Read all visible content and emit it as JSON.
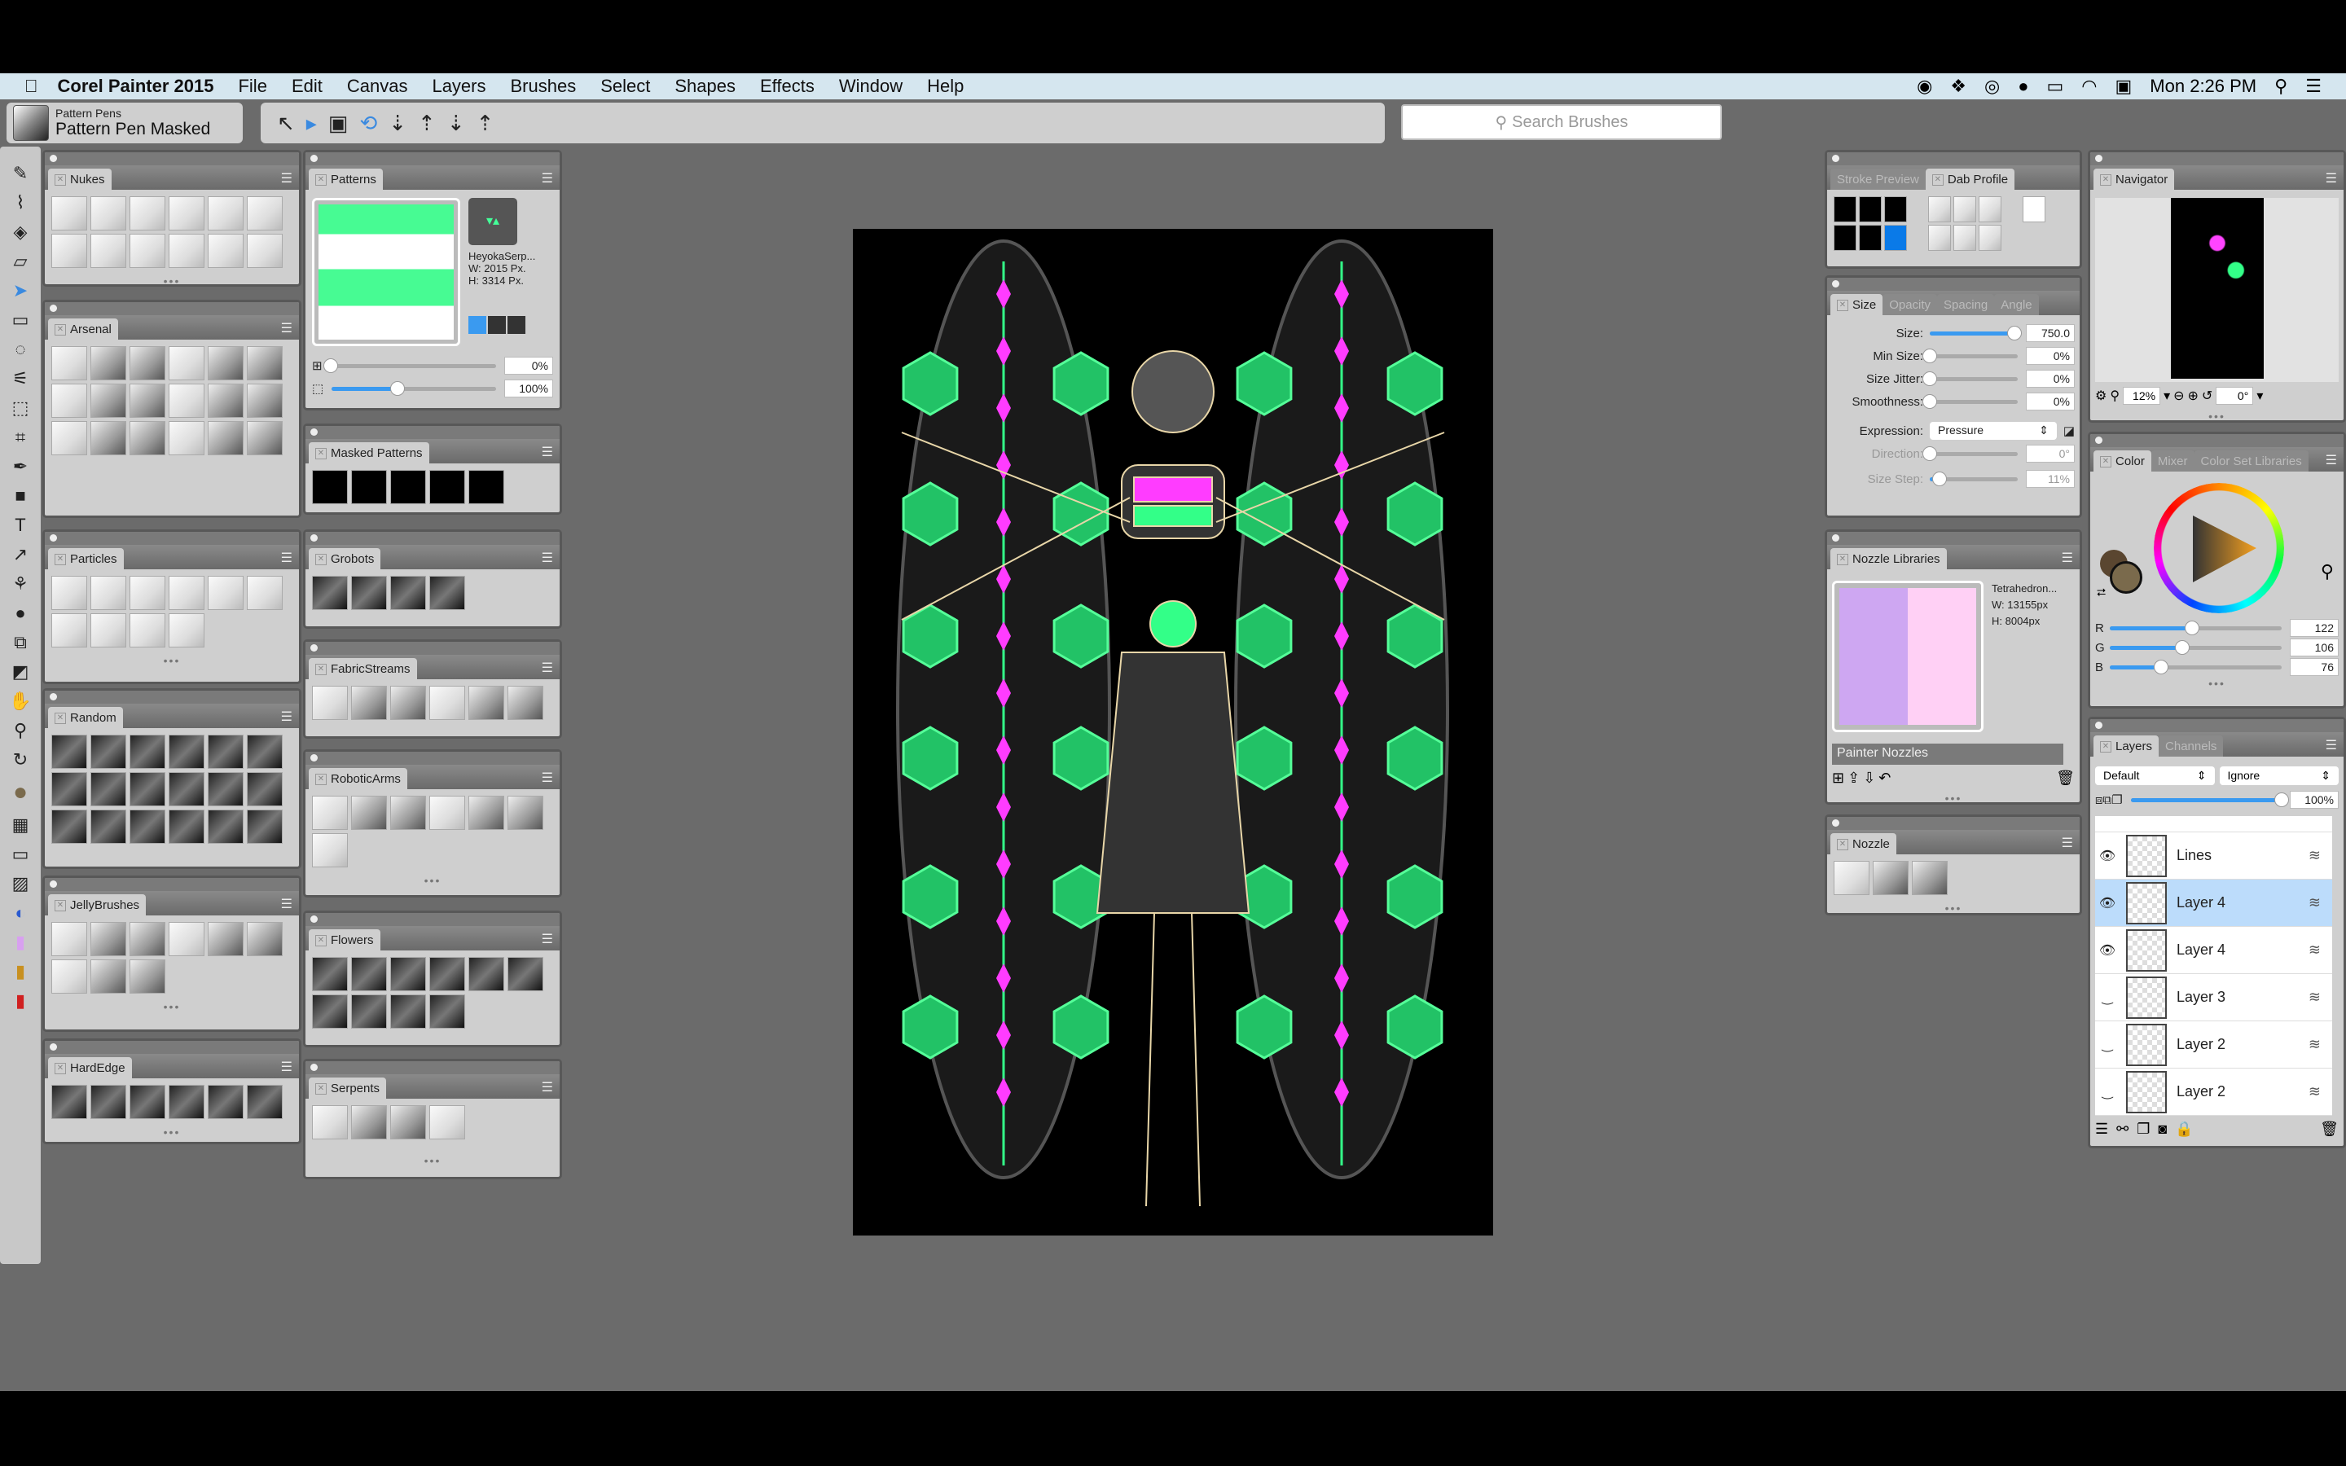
{
  "menubar": {
    "app": "Corel Painter 2015",
    "items": [
      "File",
      "Edit",
      "Canvas",
      "Layers",
      "Brushes",
      "Select",
      "Shapes",
      "Effects",
      "Window",
      "Help"
    ],
    "clock": "Mon 2:26 PM"
  },
  "toolbar": {
    "brush_category": "Pattern Pens",
    "brush_variant": "Pattern Pen Masked",
    "search_placeholder": "Search Brushes"
  },
  "left_panels": [
    {
      "title": "Nukes"
    },
    {
      "title": "Arsenal"
    },
    {
      "title": "Particles"
    },
    {
      "title": "Random"
    },
    {
      "title": "JellyBrushes"
    },
    {
      "title": "HardEdge"
    }
  ],
  "mid_panels": [
    {
      "title": "Patterns"
    },
    {
      "title": "Masked Patterns"
    },
    {
      "title": "Grobots"
    },
    {
      "title": "FabricStreams"
    },
    {
      "title": "RoboticArms"
    },
    {
      "title": "Flowers"
    },
    {
      "title": "Serpents"
    }
  ],
  "patterns": {
    "name": "HeyokaSerp...",
    "width": "W:  2015 Px.",
    "height": "H:  3314 Px.",
    "offset": "0%",
    "scale": "100%",
    "scale_value": 0.4,
    "swatch_colors": [
      "#47fb93",
      "#ffffff"
    ]
  },
  "stroke_panel": {
    "tabs": [
      "Stroke Preview",
      "Dab Profile"
    ],
    "active": "Dab Profile"
  },
  "size_panel": {
    "tabs": [
      "Size",
      "Opacity",
      "Spacing",
      "Angle"
    ],
    "rows": [
      {
        "label": "Size:",
        "value": "750.0",
        "level": 0.96
      },
      {
        "label": "Min Size:",
        "value": "0%",
        "level": 0
      },
      {
        "label": "Size Jitter:",
        "value": "0%",
        "level": 0
      },
      {
        "label": "Smoothness:",
        "value": "0%",
        "level": 0
      }
    ],
    "expression_label": "Expression:",
    "expression": "Pressure",
    "direction_label": "Direction:",
    "direction": "0°",
    "size_step_label": "Size Step:",
    "size_step": "11%"
  },
  "nozzle_libraries": {
    "title": "Nozzle Libraries",
    "name": "Tetrahedron...",
    "width": "W: 13155px",
    "height": "H: 8004px",
    "library": "Painter Nozzles",
    "colors": [
      "#cea7f2",
      "#ffd0f5"
    ]
  },
  "nozzle": {
    "title": "Nozzle"
  },
  "navigator": {
    "title": "Navigator",
    "zoom": "12%",
    "rotation": "0°"
  },
  "color": {
    "tabs": [
      "Color",
      "Mixer",
      "Color Set Libraries"
    ],
    "r": "122",
    "g": "106",
    "b": "76",
    "main_color": "#7a6a4c",
    "r_label": "R",
    "g_label": "G",
    "b_label": "B"
  },
  "layers": {
    "tabs": [
      "Layers",
      "Channels"
    ],
    "composite": "Default",
    "method": "Ignore",
    "opacity": "100%",
    "items": [
      {
        "name": "Lines",
        "visible": true
      },
      {
        "name": "Layer 4",
        "visible": true,
        "selected": true
      },
      {
        "name": "Layer 4",
        "visible": true
      },
      {
        "name": "Layer 3",
        "visible": false
      },
      {
        "name": "Layer 2",
        "visible": false
      },
      {
        "name": "Layer 2",
        "visible": false
      }
    ]
  }
}
